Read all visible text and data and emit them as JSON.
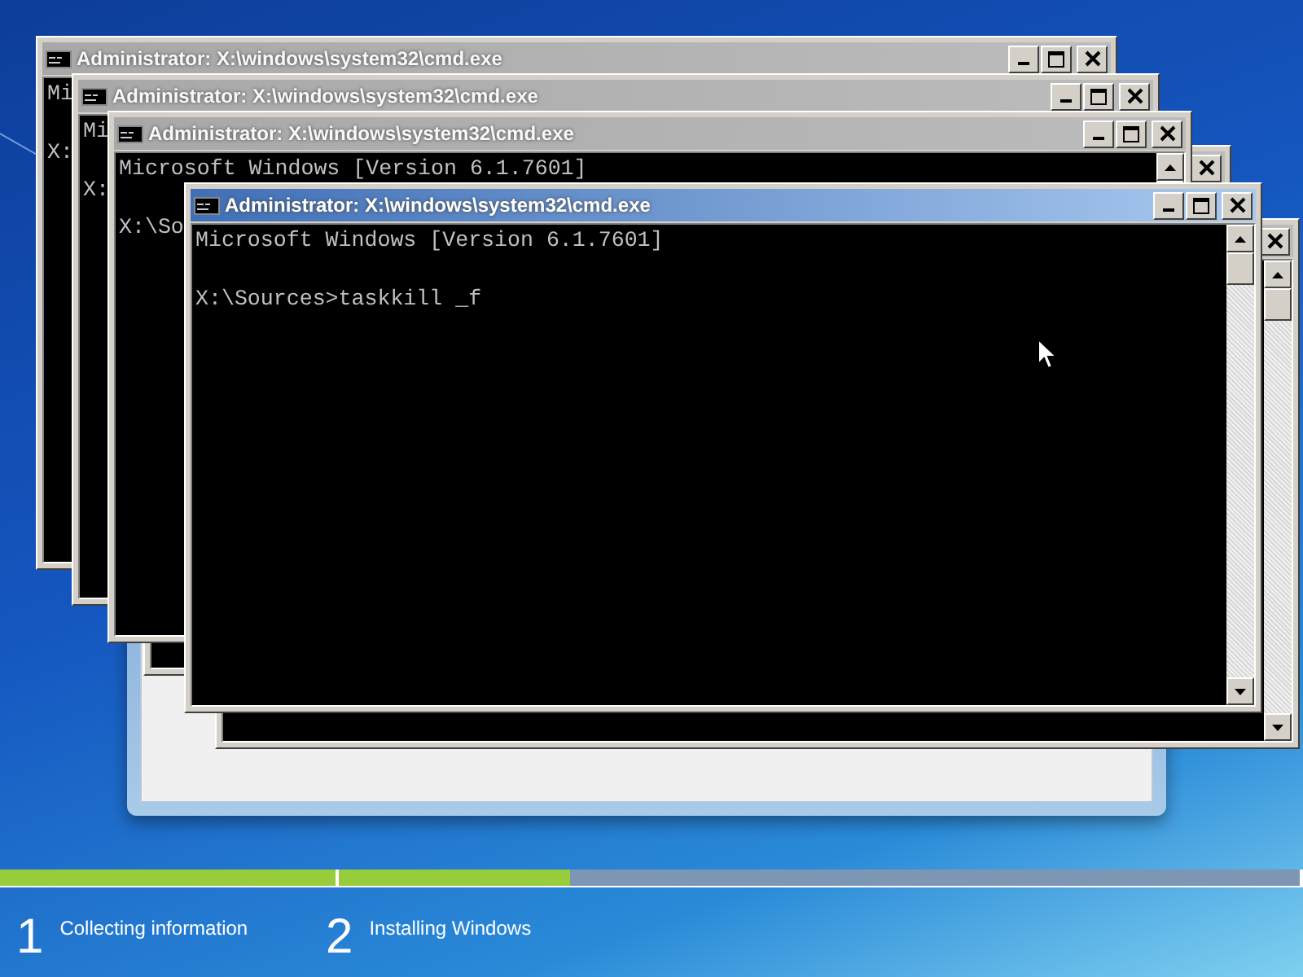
{
  "windows": [
    {
      "active": false
    },
    {
      "title": "Administrator: X:\\windows\\system32\\cmd.exe",
      "active": false,
      "lines": [
        "Mi",
        "X:"
      ]
    },
    {
      "title": "Administrator: X:\\windows\\system32\\cmd.exe",
      "active": false,
      "lines": [
        "Mi",
        "X:"
      ]
    },
    {
      "title": "Administrator: X:\\windows\\system32\\cmd.exe",
      "active": false,
      "lines": [
        "Microsoft Windows [Version 6.1.7601]",
        "X:\\So"
      ]
    },
    {
      "active": false
    },
    {
      "title": "Administrator: X:\\windows\\system32\\cmd.exe",
      "active": true,
      "lines": [
        "Microsoft Windows [Version 6.1.7601]",
        "X:\\Sources>taskkill _f"
      ]
    }
  ],
  "progress": [
    {
      "number": "1",
      "label": "Collecting information",
      "level": 1
    },
    {
      "number": "2",
      "label": "Installing Windows",
      "level": 0.24
    }
  ]
}
